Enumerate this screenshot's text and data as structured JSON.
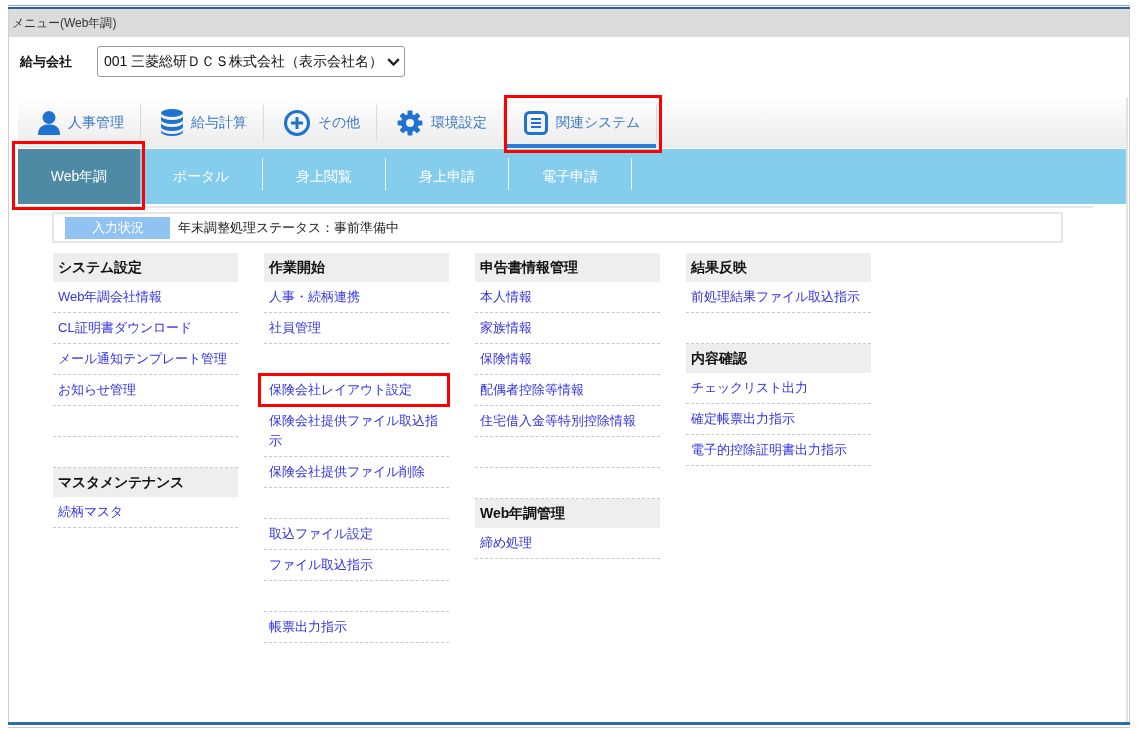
{
  "window": {
    "title": "メニュー(Web年調)"
  },
  "company": {
    "label": "給与会社",
    "value": "001 三菱総研ＤＣＳ株式会社（表示会社名）"
  },
  "main_tabs": [
    {
      "label": "人事管理",
      "selected": false,
      "highlighted": false
    },
    {
      "label": "給与計算",
      "selected": false,
      "highlighted": false
    },
    {
      "label": "その他",
      "selected": false,
      "highlighted": false
    },
    {
      "label": "環境設定",
      "selected": false,
      "highlighted": false
    },
    {
      "label": "関連システム",
      "selected": true,
      "highlighted": true
    }
  ],
  "sub_tabs": [
    {
      "label": "Web年調",
      "selected": true,
      "highlighted": true
    },
    {
      "label": "ポータル",
      "selected": false,
      "highlighted": false
    },
    {
      "label": "身上閲覧",
      "selected": false,
      "highlighted": false
    },
    {
      "label": "身上申請",
      "selected": false,
      "highlighted": false
    },
    {
      "label": "電子申請",
      "selected": false,
      "highlighted": false
    }
  ],
  "status": {
    "label": "入力状況",
    "text": "年末調整処理ステータス：事前準備中"
  },
  "menu_columns": [
    {
      "entries": [
        {
          "kind": "header",
          "label": "システム設定",
          "highlighted": false
        },
        {
          "kind": "link",
          "label": "Web年調会社情報",
          "highlighted": false
        },
        {
          "kind": "link",
          "label": "CL証明書ダウンロード",
          "highlighted": false
        },
        {
          "kind": "link",
          "label": "メール通知テンプレート管理",
          "highlighted": false
        },
        {
          "kind": "link",
          "label": "お知らせ管理",
          "highlighted": false
        },
        {
          "kind": "blank"
        },
        {
          "kind": "blank"
        },
        {
          "kind": "header",
          "label": "マスタメンテナンス",
          "highlighted": false
        },
        {
          "kind": "link",
          "label": "続柄マスタ",
          "highlighted": false
        }
      ]
    },
    {
      "entries": [
        {
          "kind": "header",
          "label": "作業開始",
          "highlighted": false
        },
        {
          "kind": "link",
          "label": "人事・続柄連携",
          "highlighted": false
        },
        {
          "kind": "link",
          "label": "社員管理",
          "highlighted": false
        },
        {
          "kind": "blank"
        },
        {
          "kind": "link",
          "label": "保険会社レイアウト設定",
          "highlighted": true
        },
        {
          "kind": "link",
          "label": "保険会社提供ファイル取込指示",
          "highlighted": false
        },
        {
          "kind": "link",
          "label": "保険会社提供ファイル削除",
          "highlighted": false
        },
        {
          "kind": "blank"
        },
        {
          "kind": "link",
          "label": "取込ファイル設定",
          "highlighted": false
        },
        {
          "kind": "link",
          "label": "ファイル取込指示",
          "highlighted": false
        },
        {
          "kind": "blank"
        },
        {
          "kind": "link",
          "label": "帳票出力指示",
          "highlighted": false
        }
      ]
    },
    {
      "entries": [
        {
          "kind": "header",
          "label": "申告書情報管理",
          "highlighted": false
        },
        {
          "kind": "link",
          "label": "本人情報",
          "highlighted": false
        },
        {
          "kind": "link",
          "label": "家族情報",
          "highlighted": false
        },
        {
          "kind": "link",
          "label": "保険情報",
          "highlighted": false
        },
        {
          "kind": "link",
          "label": "配偶者控除等情報",
          "highlighted": false
        },
        {
          "kind": "link",
          "label": "住宅借入金等特別控除情報",
          "highlighted": false
        },
        {
          "kind": "blank"
        },
        {
          "kind": "blank"
        },
        {
          "kind": "header",
          "label": "Web年調管理",
          "highlighted": false
        },
        {
          "kind": "link",
          "label": "締め処理",
          "highlighted": false
        }
      ]
    },
    {
      "entries": [
        {
          "kind": "header",
          "label": "結果反映",
          "highlighted": false
        },
        {
          "kind": "link",
          "label": "前処理結果ファイル取込指示",
          "highlighted": false
        },
        {
          "kind": "blank"
        },
        {
          "kind": "header",
          "label": "内容確認",
          "highlighted": false
        },
        {
          "kind": "link",
          "label": "チェックリスト出力",
          "highlighted": false
        },
        {
          "kind": "link",
          "label": "確定帳票出力指示",
          "highlighted": false
        },
        {
          "kind": "link",
          "label": "電子的控除証明書出力指示",
          "highlighted": false
        }
      ]
    }
  ]
}
